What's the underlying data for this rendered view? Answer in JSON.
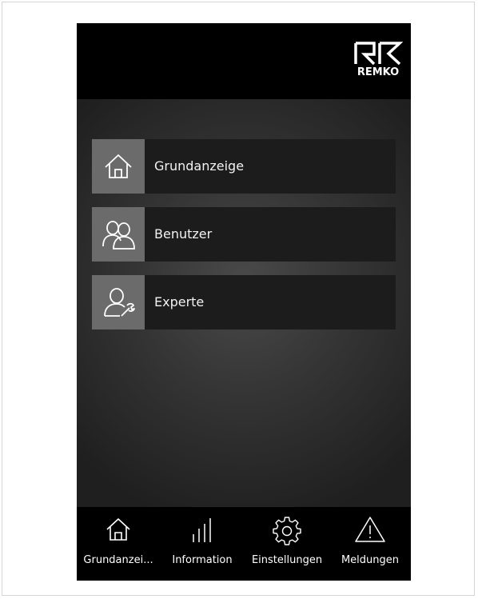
{
  "brand": {
    "logo_text": "REMKO"
  },
  "menu": {
    "items": [
      {
        "label": "Grundanzeige",
        "icon": "home-icon"
      },
      {
        "label": "Benutzer",
        "icon": "users-icon"
      },
      {
        "label": "Experte",
        "icon": "expert-user-wrench-icon"
      }
    ]
  },
  "navbar": {
    "items": [
      {
        "label": "Grundanzei...",
        "icon": "home-icon"
      },
      {
        "label": "Information",
        "icon": "bar-chart-icon"
      },
      {
        "label": "Einstellungen",
        "icon": "gear-icon"
      },
      {
        "label": "Meldungen",
        "icon": "warning-icon"
      }
    ]
  },
  "colors": {
    "background": "#000000",
    "menu_item_bg": "#1c1c1c",
    "icon_box_bg": "#6b6b6b",
    "text": "#f2f2f2"
  }
}
